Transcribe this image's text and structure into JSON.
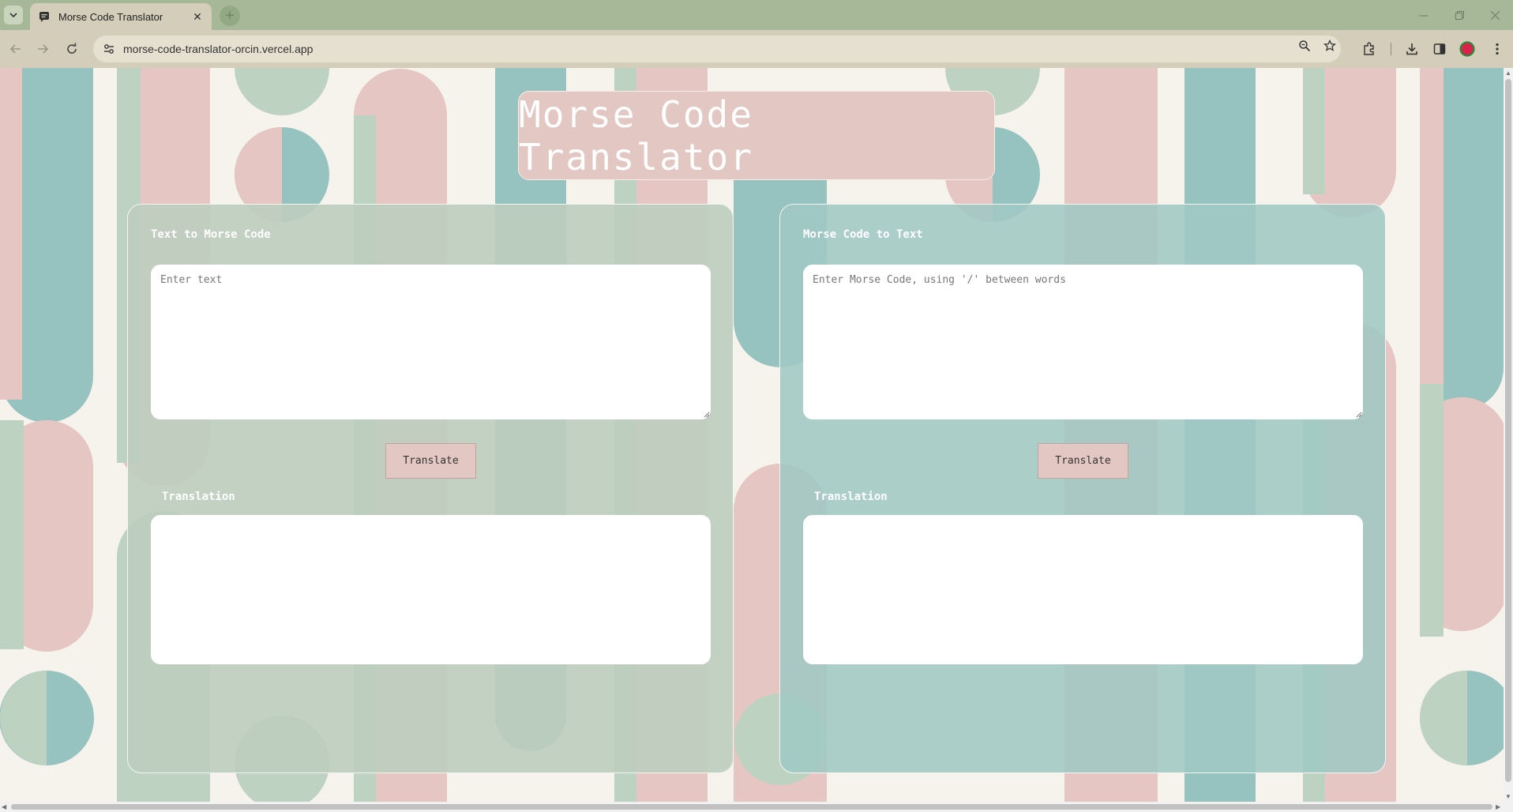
{
  "browser": {
    "tab_title": "Morse Code Translator",
    "new_tab_symbol": "+",
    "url": "morse-code-translator-orcin.vercel.app",
    "icons": [
      "tab-search-icon",
      "chat-favicon-icon",
      "close-icon",
      "minimize-icon",
      "restore-icon",
      "window-close-icon",
      "back-icon",
      "forward-icon",
      "reload-icon",
      "site-settings-icon",
      "zoom-icon",
      "bookmark-star-icon",
      "extensions-icon",
      "downloads-icon",
      "side-panel-icon",
      "profile-icon",
      "menu-icon"
    ]
  },
  "app": {
    "title": "Morse Code Translator",
    "text_to_morse": {
      "heading": "Text to Morse Code",
      "input_value": "",
      "input_placeholder": "Enter text",
      "button_label": "Translate",
      "output_label": "Translation",
      "output_value": ""
    },
    "morse_to_text": {
      "heading": "Morse Code to Text",
      "input_value": "",
      "input_placeholder": "Enter Morse Code, using '/' between words",
      "button_label": "Translate",
      "output_label": "Translation",
      "output_value": ""
    }
  },
  "colors": {
    "teal": "#96c2c0",
    "pink": "#e5c6c2",
    "sage": "#bed2c2",
    "cream": "#f6f2ec",
    "title_bg": "#e2c7c2",
    "left_panel": "#bdcdbe",
    "right_panel": "#a0c8c4",
    "chrome_frame": "#a7b899",
    "chrome_toolbar": "#d3cdb9"
  }
}
